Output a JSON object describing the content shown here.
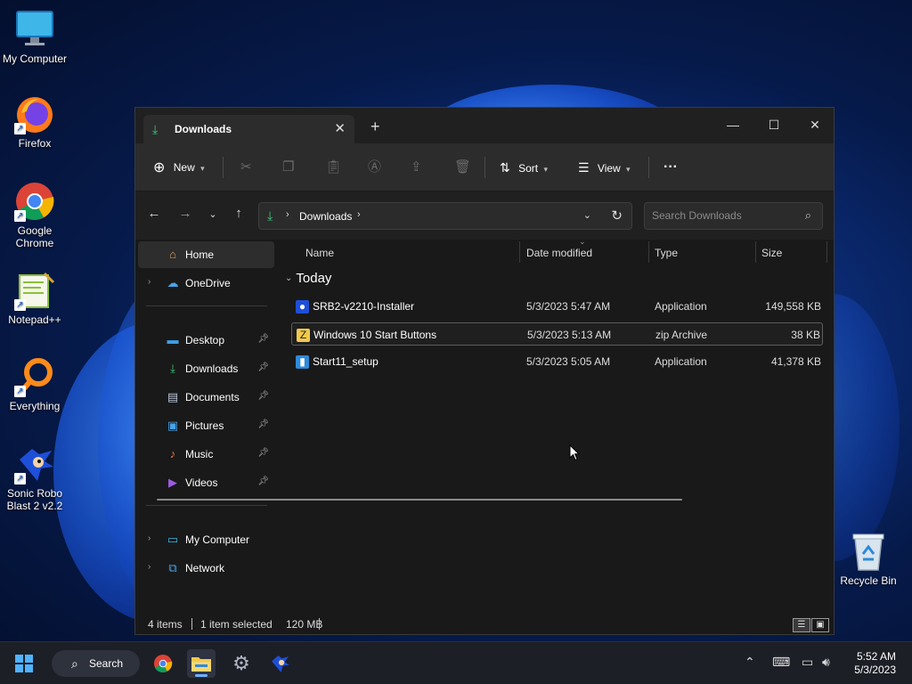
{
  "desktop": {
    "icons": [
      {
        "label": "My Computer"
      },
      {
        "label": "Firefox"
      },
      {
        "label": "Google\nChrome"
      },
      {
        "label": "Notepad++"
      },
      {
        "label": "Everything"
      },
      {
        "label": "Sonic Robo\nBlast 2 v2.2"
      },
      {
        "label": "Recycle Bin"
      }
    ]
  },
  "window": {
    "tab_title": "Downloads",
    "tab_close": "✕",
    "new_tab": "+",
    "controls": {
      "minimize": "—",
      "maximize": "☐",
      "close": "✕"
    },
    "toolbar": {
      "new_label": "New",
      "sort_label": "Sort",
      "view_label": "View",
      "more": "···"
    },
    "address": {
      "path": "Downloads"
    },
    "search": {
      "placeholder": "Search Downloads"
    }
  },
  "sidebar": {
    "home": "Home",
    "onedrive": "OneDrive",
    "quick": [
      {
        "label": "Desktop",
        "icon": "desktop-folder-icon",
        "color": "#3aa0e8"
      },
      {
        "label": "Downloads",
        "icon": "download-arrow-icon",
        "color": "#3cc87a"
      },
      {
        "label": "Documents",
        "icon": "document-icon",
        "color": "#b9c4d6"
      },
      {
        "label": "Pictures",
        "icon": "pictures-icon",
        "color": "#4aa3e8"
      },
      {
        "label": "Music",
        "icon": "music-icon",
        "color": "#e8764a"
      },
      {
        "label": "Videos",
        "icon": "videos-icon",
        "color": "#9b5ce0"
      }
    ],
    "my_computer": "My Computer",
    "network": "Network"
  },
  "file_list": {
    "columns": {
      "name": "Name",
      "date": "Date modified",
      "type": "Type",
      "size": "Size"
    },
    "group": "Today",
    "rows": [
      {
        "name": "SRB2-v2210-Installer",
        "date": "5/3/2023 5:47 AM",
        "type": "Application",
        "size": "149,558 KB",
        "selected": false
      },
      {
        "name": "Windows 10 Start Buttons",
        "date": "5/3/2023 5:13 AM",
        "type": "zip Archive",
        "size": "38 KB",
        "selected": true
      },
      {
        "name": "Start11_setup",
        "date": "5/3/2023 5:05 AM",
        "type": "Application",
        "size": "41,378 KB",
        "selected": false
      }
    ]
  },
  "status": {
    "items": "4 items",
    "selected": "1 item selected",
    "size": "120 MB"
  },
  "taskbar": {
    "search_label": "Search",
    "time": "5:52 AM",
    "date": "5/3/2023"
  },
  "colors": {
    "accent": "#3cc87a",
    "window_bg": "#191919",
    "taskbar_bg": "#1c1f26"
  }
}
